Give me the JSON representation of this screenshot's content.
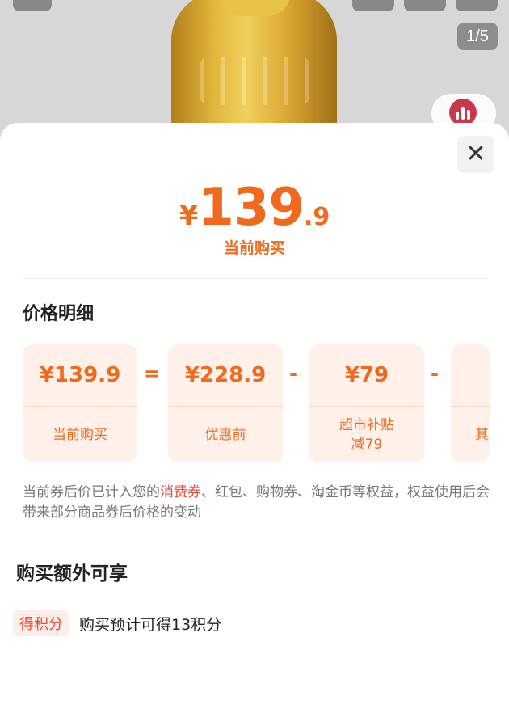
{
  "image_counter": "1/5",
  "price": {
    "currency": "¥",
    "integer": "139",
    "decimal": ".9",
    "label": "当前购买"
  },
  "breakdown": {
    "title": "价格明细",
    "cards": [
      {
        "amount": "¥139.9",
        "label": "当前购买"
      },
      {
        "amount": "¥228.9",
        "label": "优惠前"
      },
      {
        "amount": "¥79",
        "label": "超市补贴\n减79"
      },
      {
        "amount": "",
        "label": "其"
      }
    ],
    "operators": [
      "=",
      "-",
      "-"
    ],
    "note_before": "当前券后价已计入您的",
    "note_highlight": "消费券",
    "note_after": "、红包、购物券、淘金币等权益，权益使用后会带来部分商品券后价格的变动"
  },
  "extras": {
    "title": "购买额外可享",
    "badge": "得积分",
    "text": "购买预计可得13积分"
  },
  "colors": {
    "accent": "#f06a1e",
    "highlight": "#e94a34",
    "card_bg": "#fff1ea"
  }
}
